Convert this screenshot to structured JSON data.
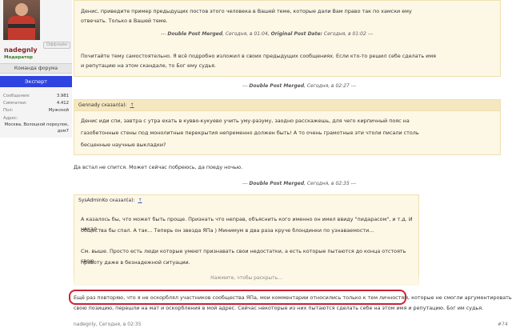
{
  "user": {
    "username": "nadegnly",
    "status": "Оффлайн",
    "role": "Модератор",
    "team_button": "Команда форума",
    "expert_button": "Эксперт",
    "stats": [
      {
        "label": "Сообщения:",
        "value": "3.981"
      },
      {
        "label": "Симпатии:",
        "value": "4.412"
      },
      {
        "label": "Пол:",
        "value": "Мужской"
      }
    ],
    "address_label": "Адрес:",
    "address_value_line1": "Москва, Волоцкой переулок,",
    "address_value_line2": "дом7"
  },
  "post": {
    "block1_line1": "Денис, приведите пример предыдущих постов этого человека в Вашей теме, которые дали Вам право так по хамски ему",
    "block1_line2": "отвечать. Только в Вашей теме.",
    "merge1": {
      "label": "Double Post Merged",
      "date": "Сегодня, в 01:04",
      "orig_label": "Original Post Date:",
      "orig_date": "Сегодня, в 01:02"
    },
    "block1_line3": "Почитайте тему самостоятельно. Я всё подробно изложил в своих предыдущих сообщениях. Если кто-то решил себе сделать имя",
    "block1_line4": "и репутацию на этом скандале, то Бог ему судья.",
    "merge2": {
      "label": "Double Post Merged",
      "date": "Сегодня, в 02:27"
    },
    "quote2_author": "Gennady сказал(а):",
    "quote2_arrow": "↑",
    "quote2_line1": "Денис иди спи, завтра с утра ехать в кувво-кукуево учить уму-разуму, заодно расскажешь, для чего кирпичный пояс на",
    "quote2_line2": "газобетонные стены под монолитные перекрытия непременно должен быть! А то очень грамотные эти чтоли писали столь",
    "quote2_line3": "бесценные научные выкладки?",
    "reply2": "Да встал не спится. Может сейчас побреюсь, да поеду ночью.",
    "merge3": {
      "label": "Double Post Merged",
      "date": "Сегодня, в 02:35"
    },
    "quote3_author": "SysAdminKo сказал(а):",
    "quote3_arrow": "↑",
    "quote3_line1": "А казалось бы, что может быть проще. Признать что неправ, объяснить кого именно он имел ввиду \"пидарасом\", и т.д. И накал",
    "quote3_line2": "общества бы спал. А так... Теперь он звезда ЯПа ) Минимум в два раза круче блондинки по узнаваемости...",
    "quote3_line3": "См. выше. Просто есть люди которые умеют признавать свои недостатки, а есть которые пытаются до конца отстоять свою",
    "quote3_line4": "правоту даже в безнадежной ситуации.",
    "spoiler": "Нажмите, чтобы раскрыть...",
    "final_line1": "Ещё раз повторяю, что я не оскорблял участников сообщества ЯПа, мои комментарии относились только к тем личностям, которые не смогли аргументировать",
    "final_line2": "свою позицию, перешли на мат и оскорбления в мой адрес. Сейчас некоторые из них пытаются сделать себе на этом имя и репутацию. Бог им судья.",
    "footer_author_date": "nadegnly, Сегодня, в 02:35",
    "post_number": "#74"
  }
}
